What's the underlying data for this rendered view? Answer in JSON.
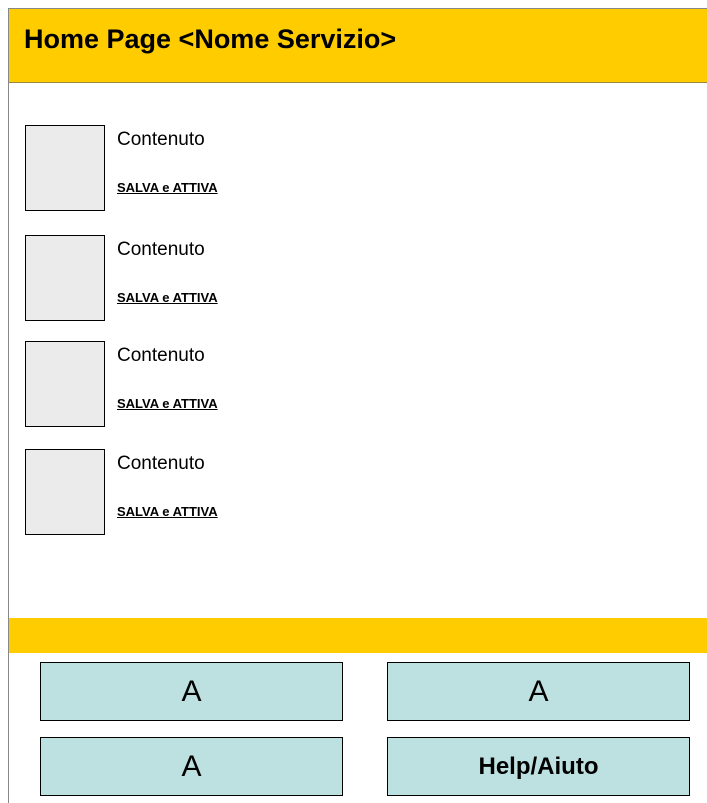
{
  "header": {
    "title": "Home Page <Nome Servizio>"
  },
  "content": {
    "items": [
      {
        "text": "Contenuto",
        "link_label": "SALVA e ATTIVA"
      },
      {
        "text": "Contenuto",
        "link_label": "SALVA e ATTIVA"
      },
      {
        "text": "Contenuto",
        "link_label": "SALVA e ATTIVA"
      },
      {
        "text": "Contenuto",
        "link_label": "SALVA e ATTIVA"
      }
    ]
  },
  "tiles": [
    {
      "label": "A"
    },
    {
      "label": "A"
    },
    {
      "label": "A"
    },
    {
      "label": "Help/Aiuto"
    }
  ],
  "colors": {
    "accent_bar": "#ffcc00",
    "tile_fill": "#bde0e1",
    "placeholder_fill": "#ebebeb"
  }
}
